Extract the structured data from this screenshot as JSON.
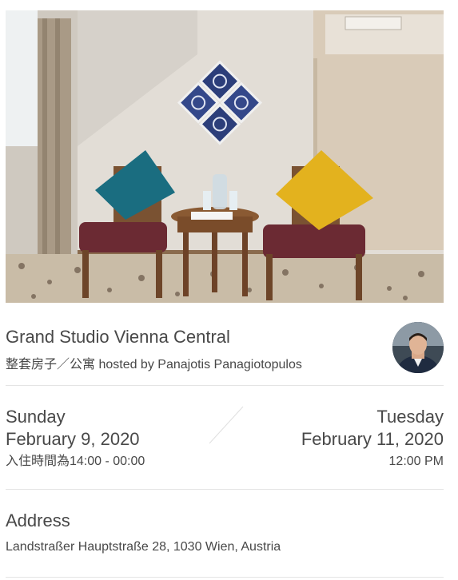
{
  "listing": {
    "title": "Grand Studio Vienna Central",
    "subtitle": "整套房子／公寓 hosted by Panajotis Panagiotopulos"
  },
  "checkin": {
    "day": "Sunday",
    "date": "February 9, 2020",
    "time": "入住時間為14:00 - 00:00"
  },
  "checkout": {
    "day": "Tuesday",
    "date": "February 11, 2020",
    "time": "12:00 PM"
  },
  "address": {
    "label": "Address",
    "value": "Landstraßer Hauptstraße 28, 1030 Wien, Austria"
  },
  "icons": {
    "avatar": "host-avatar",
    "photo": "listing-photo",
    "separator": "date-slash-icon"
  }
}
